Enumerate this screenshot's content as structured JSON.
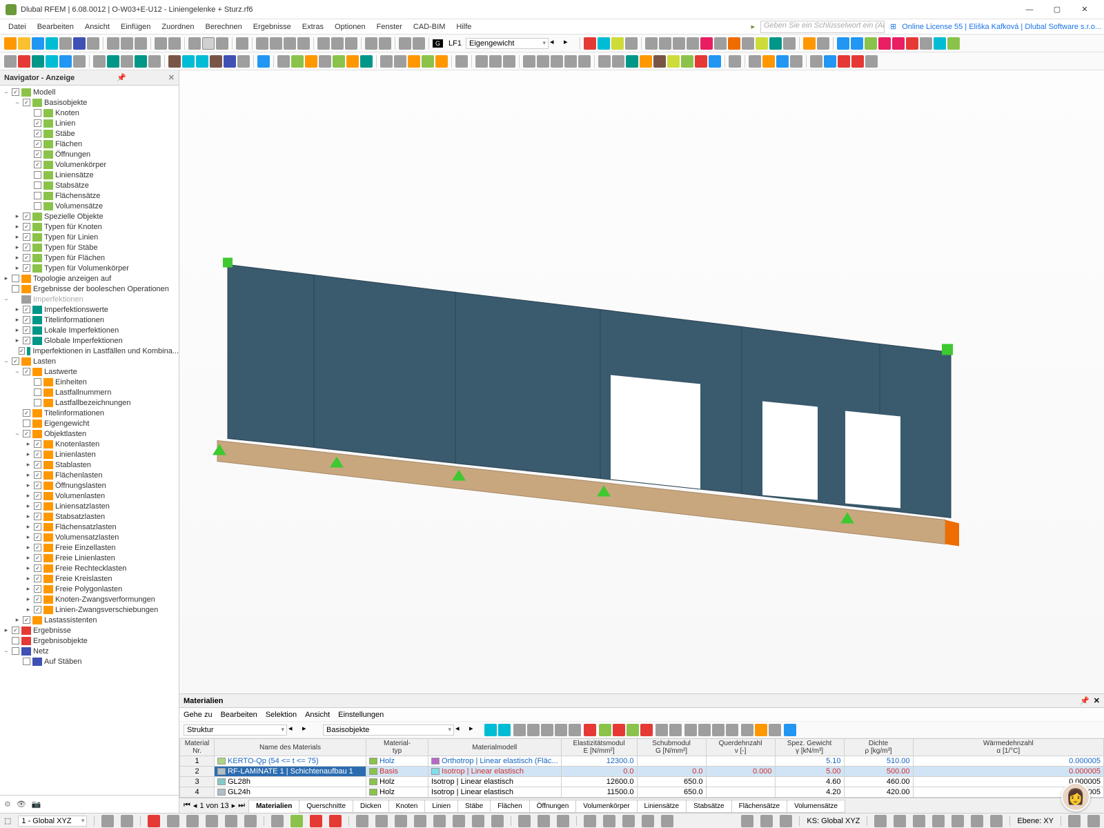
{
  "title": "Dlubal RFEM | 6.08.0012 | O-W03+E-U12 - Liniengelenke + Sturz.rf6",
  "menus": [
    "Datei",
    "Bearbeiten",
    "Ansicht",
    "Einfügen",
    "Zuordnen",
    "Berechnen",
    "Ergebnisse",
    "Extras",
    "Optionen",
    "Fenster",
    "CAD-BIM",
    "Hilfe"
  ],
  "search_placeholder": "Geben Sie ein Schlüsselwort ein (Alt...",
  "license": "Online License 55 | Eliška Kafková | Dlubal Software s.r.o...",
  "lf_code": "LF1",
  "lf_name": "Eigengewicht",
  "nav_title": "Navigator - Anzeige",
  "tree": [
    {
      "d": 0,
      "e": "−",
      "c": 1,
      "i": "ico-green",
      "l": "Modell"
    },
    {
      "d": 1,
      "e": "−",
      "c": 1,
      "i": "ico-green",
      "l": "Basisobjekte"
    },
    {
      "d": 2,
      "e": "",
      "c": 0,
      "i": "ico-green",
      "l": "Knoten"
    },
    {
      "d": 2,
      "e": "",
      "c": 1,
      "i": "ico-green",
      "l": "Linien"
    },
    {
      "d": 2,
      "e": "",
      "c": 1,
      "i": "ico-green",
      "l": "Stäbe"
    },
    {
      "d": 2,
      "e": "",
      "c": 1,
      "i": "ico-green",
      "l": "Flächen"
    },
    {
      "d": 2,
      "e": "",
      "c": 1,
      "i": "ico-green",
      "l": "Öffnungen"
    },
    {
      "d": 2,
      "e": "",
      "c": 1,
      "i": "ico-green",
      "l": "Volumenkörper"
    },
    {
      "d": 2,
      "e": "",
      "c": 0,
      "i": "ico-green",
      "l": "Liniensätze"
    },
    {
      "d": 2,
      "e": "",
      "c": 0,
      "i": "ico-green",
      "l": "Stabsätze"
    },
    {
      "d": 2,
      "e": "",
      "c": 0,
      "i": "ico-green",
      "l": "Flächensätze"
    },
    {
      "d": 2,
      "e": "",
      "c": 0,
      "i": "ico-green",
      "l": "Volumensätze"
    },
    {
      "d": 1,
      "e": "▸",
      "c": 1,
      "i": "ico-green",
      "l": "Spezielle Objekte"
    },
    {
      "d": 1,
      "e": "▸",
      "c": 1,
      "i": "ico-green",
      "l": "Typen für Knoten"
    },
    {
      "d": 1,
      "e": "▸",
      "c": 1,
      "i": "ico-green",
      "l": "Typen für Linien"
    },
    {
      "d": 1,
      "e": "▸",
      "c": 1,
      "i": "ico-green",
      "l": "Typen für Stäbe"
    },
    {
      "d": 1,
      "e": "▸",
      "c": 1,
      "i": "ico-green",
      "l": "Typen für Flächen"
    },
    {
      "d": 1,
      "e": "▸",
      "c": 1,
      "i": "ico-green",
      "l": "Typen für Volumenkörper"
    },
    {
      "d": 0,
      "e": "▸",
      "c": 0,
      "i": "ico-orange",
      "l": "Topologie anzeigen auf"
    },
    {
      "d": 0,
      "e": "",
      "c": 0,
      "i": "ico-orange",
      "l": "Ergebnisse der booleschen Operationen"
    },
    {
      "d": 0,
      "e": "−",
      "c": null,
      "i": "ico-grey",
      "l": "Imperfektionen",
      "dis": 1
    },
    {
      "d": 1,
      "e": "▸",
      "c": 1,
      "i": "ico-teal",
      "l": "Imperfektionswerte"
    },
    {
      "d": 1,
      "e": "▸",
      "c": 1,
      "i": "ico-teal",
      "l": "Titelinformationen"
    },
    {
      "d": 1,
      "e": "▸",
      "c": 1,
      "i": "ico-teal",
      "l": "Lokale Imperfektionen"
    },
    {
      "d": 1,
      "e": "▸",
      "c": 1,
      "i": "ico-teal",
      "l": "Globale Imperfektionen"
    },
    {
      "d": 1,
      "e": "",
      "c": 1,
      "i": "ico-teal",
      "l": "Imperfektionen in Lastfällen und Kombina..."
    },
    {
      "d": 0,
      "e": "−",
      "c": 1,
      "i": "ico-orange",
      "l": "Lasten"
    },
    {
      "d": 1,
      "e": "−",
      "c": 1,
      "i": "ico-orange",
      "l": "Lastwerte"
    },
    {
      "d": 2,
      "e": "",
      "c": 0,
      "i": "ico-orange",
      "l": "Einheiten"
    },
    {
      "d": 2,
      "e": "",
      "c": 0,
      "i": "ico-orange",
      "l": "Lastfallnummern"
    },
    {
      "d": 2,
      "e": "",
      "c": 0,
      "i": "ico-orange",
      "l": "Lastfallbezeichnungen"
    },
    {
      "d": 1,
      "e": "",
      "c": 1,
      "i": "ico-orange",
      "l": "Titelinformationen"
    },
    {
      "d": 1,
      "e": "",
      "c": 0,
      "i": "ico-orange",
      "l": "Eigengewicht"
    },
    {
      "d": 1,
      "e": "−",
      "c": 1,
      "i": "ico-orange",
      "l": "Objektlasten"
    },
    {
      "d": 2,
      "e": "▸",
      "c": 1,
      "i": "ico-orange",
      "l": "Knotenlasten"
    },
    {
      "d": 2,
      "e": "▸",
      "c": 1,
      "i": "ico-orange",
      "l": "Linienlasten"
    },
    {
      "d": 2,
      "e": "▸",
      "c": 1,
      "i": "ico-orange",
      "l": "Stablasten"
    },
    {
      "d": 2,
      "e": "▸",
      "c": 1,
      "i": "ico-orange",
      "l": "Flächenlasten"
    },
    {
      "d": 2,
      "e": "▸",
      "c": 1,
      "i": "ico-orange",
      "l": "Öffnungslasten"
    },
    {
      "d": 2,
      "e": "▸",
      "c": 1,
      "i": "ico-orange",
      "l": "Volumenlasten"
    },
    {
      "d": 2,
      "e": "▸",
      "c": 1,
      "i": "ico-orange",
      "l": "Liniensatzlasten"
    },
    {
      "d": 2,
      "e": "▸",
      "c": 1,
      "i": "ico-orange",
      "l": "Stabsatzlasten"
    },
    {
      "d": 2,
      "e": "▸",
      "c": 1,
      "i": "ico-orange",
      "l": "Flächensatzlasten"
    },
    {
      "d": 2,
      "e": "▸",
      "c": 1,
      "i": "ico-orange",
      "l": "Volumensatzlasten"
    },
    {
      "d": 2,
      "e": "▸",
      "c": 1,
      "i": "ico-orange",
      "l": "Freie Einzellasten"
    },
    {
      "d": 2,
      "e": "▸",
      "c": 1,
      "i": "ico-orange",
      "l": "Freie Linienlasten"
    },
    {
      "d": 2,
      "e": "▸",
      "c": 1,
      "i": "ico-orange",
      "l": "Freie Rechtecklasten"
    },
    {
      "d": 2,
      "e": "▸",
      "c": 1,
      "i": "ico-orange",
      "l": "Freie Kreislasten"
    },
    {
      "d": 2,
      "e": "▸",
      "c": 1,
      "i": "ico-orange",
      "l": "Freie Polygonlasten"
    },
    {
      "d": 2,
      "e": "▸",
      "c": 1,
      "i": "ico-orange",
      "l": "Knoten-Zwangsverformungen"
    },
    {
      "d": 2,
      "e": "▸",
      "c": 1,
      "i": "ico-orange",
      "l": "Linien-Zwangsverschiebungen"
    },
    {
      "d": 1,
      "e": "▸",
      "c": 1,
      "i": "ico-orange",
      "l": "Lastassistenten"
    },
    {
      "d": 0,
      "e": "▸",
      "c": 1,
      "i": "ico-red",
      "l": "Ergebnisse"
    },
    {
      "d": 0,
      "e": "",
      "c": 0,
      "i": "ico-red",
      "l": "Ergebnisobjekte"
    },
    {
      "d": 0,
      "e": "−",
      "c": 0,
      "i": "ico-navy",
      "l": "Netz"
    },
    {
      "d": 1,
      "e": "",
      "c": 0,
      "i": "ico-navy",
      "l": "Auf Stäben"
    }
  ],
  "mat_panel_title": "Materialien",
  "mat_menus": [
    "Gehe zu",
    "Bearbeiten",
    "Selektion",
    "Ansicht",
    "Einstellungen"
  ],
  "mat_combo1": "Struktur",
  "mat_combo2": "Basisobjekte",
  "mat_headers": {
    "nr": "Material\nNr.",
    "name": "Name des Materials",
    "typ": "Material-\ntyp",
    "modell": "Materialmodell",
    "e": "Elastizitätsmodul\nE [N/mm²]",
    "g": "Schubmodul\nG [N/mm²]",
    "v": "Querdehnzahl\nν [-]",
    "gamma": "Spez. Gewicht\nγ [kN/m³]",
    "rho": "Dichte\nρ [kg/m³]",
    "alpha": "Wärmedehnzahl\nα [1/°C]"
  },
  "mat_rows": [
    {
      "nr": "1",
      "name": "KERTO-Qp (54 <= t <= 75)",
      "sw": "#aed581",
      "typ": "Holz",
      "swm": "#ba68c8",
      "modell": "Orthotrop | Linear elastisch (Fläc...",
      "e": "12300.0",
      "g": "",
      "v": "",
      "gamma": "5.10",
      "rho": "510.00",
      "alpha": "0.000005",
      "cls": "blue"
    },
    {
      "nr": "2",
      "name": "RF-LAMINATE 1 | Schichtenaufbau 1",
      "sw": "#b0bec5",
      "typ": "Basis",
      "swm": "#80deea",
      "modell": "Isotrop | Linear elastisch",
      "e": "0.0",
      "g": "0.0",
      "v": "0.000",
      "gamma": "5.00",
      "rho": "500.00",
      "alpha": "0.000005",
      "cls": "red",
      "sel": 1
    },
    {
      "nr": "3",
      "name": "GL28h",
      "sw": "#80cbc4",
      "typ": "Holz",
      "swm": "",
      "modell": "Isotrop | Linear elastisch",
      "e": "12600.0",
      "g": "650.0",
      "v": "",
      "gamma": "4.60",
      "rho": "460.00",
      "alpha": "0.000005"
    },
    {
      "nr": "4",
      "name": "GL24h",
      "sw": "#b0bec5",
      "typ": "Holz",
      "swm": "",
      "modell": "Isotrop | Linear elastisch",
      "e": "11500.0",
      "g": "650.0",
      "v": "",
      "gamma": "4.20",
      "rho": "420.00",
      "alpha": "0005"
    }
  ],
  "pager": "1 von 13",
  "mat_tabs": [
    "Materialien",
    "Querschnitte",
    "Dicken",
    "Knoten",
    "Linien",
    "Stäbe",
    "Flächen",
    "Öffnungen",
    "Volumenkörper",
    "Liniensätze",
    "Stabsätze",
    "Flächensätze",
    "Volumensätze"
  ],
  "status_cs": "1 - Global XYZ",
  "status_ks": "KS: Global XYZ",
  "status_plane": "Ebene: XY"
}
